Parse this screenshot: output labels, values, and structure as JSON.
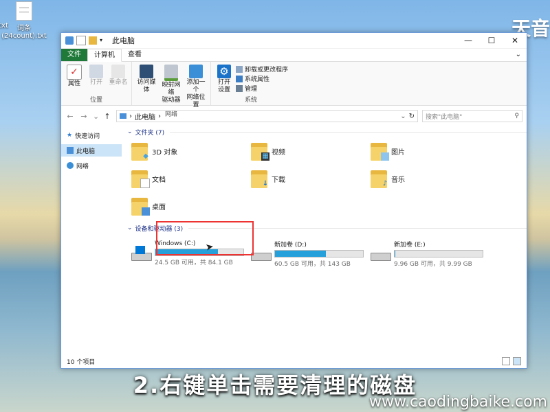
{
  "desktop": {
    "icon_label_left": "txt",
    "icon_label": "词条\n(24count).txt",
    "brand": "天音",
    "caption": "2.右键单击需要清理的磁盘",
    "watermark": "www.caodingbaike.com"
  },
  "window": {
    "title": "此电脑",
    "controls": {
      "minimize": "—",
      "maximize": "☐",
      "close": "✕"
    },
    "menu": [
      "文件",
      "计算机",
      "查看"
    ],
    "ribbon": {
      "location_group": {
        "label": "位置",
        "items": [
          "属性",
          "打开",
          "重命名"
        ]
      },
      "network_group": {
        "label": "网络",
        "items": [
          "访问媒体",
          "映射网络\n驱动器",
          "添加一个\n网络位置"
        ]
      },
      "system_group": {
        "label": "系统",
        "open": "打开\n设置",
        "links": [
          "卸载或更改程序",
          "系统属性",
          "管理"
        ]
      }
    },
    "address": {
      "path": "此电脑",
      "search_placeholder": "搜索\"此电脑\""
    },
    "nav": [
      "快速访问",
      "此电脑",
      "网络"
    ],
    "folders_header": "文件夹 (7)",
    "folders": [
      {
        "name": "3D 对象",
        "badge": "cube-icon"
      },
      {
        "name": "视频",
        "badge": "film-icon"
      },
      {
        "name": "图片",
        "badge": "picture-icon"
      },
      {
        "name": "文档",
        "badge": "document-icon"
      },
      {
        "name": "下载",
        "badge": "download-arrow-icon"
      },
      {
        "name": "音乐",
        "badge": "music-note-icon"
      },
      {
        "name": "桌面",
        "badge": "desktop-icon"
      }
    ],
    "drives_header": "设备和驱动器 (3)",
    "drives": [
      {
        "name": "Windows (C:)",
        "free": "24.5 GB 可用，共 84.1 GB",
        "used_fraction": 0.71
      },
      {
        "name": "新加卷 (D:)",
        "free": "60.5 GB 可用，共 143 GB",
        "used_fraction": 0.58
      },
      {
        "name": "新加卷 (E:)",
        "free": "9.96 GB 可用，共 9.99 GB",
        "used_fraction": 0.01
      }
    ],
    "status": "10 个项目",
    "colors": {
      "accent": "#0078d7",
      "file_tab": "#1f7a3a",
      "bar_fill": "#26a0da",
      "highlight": "#e33333"
    }
  }
}
